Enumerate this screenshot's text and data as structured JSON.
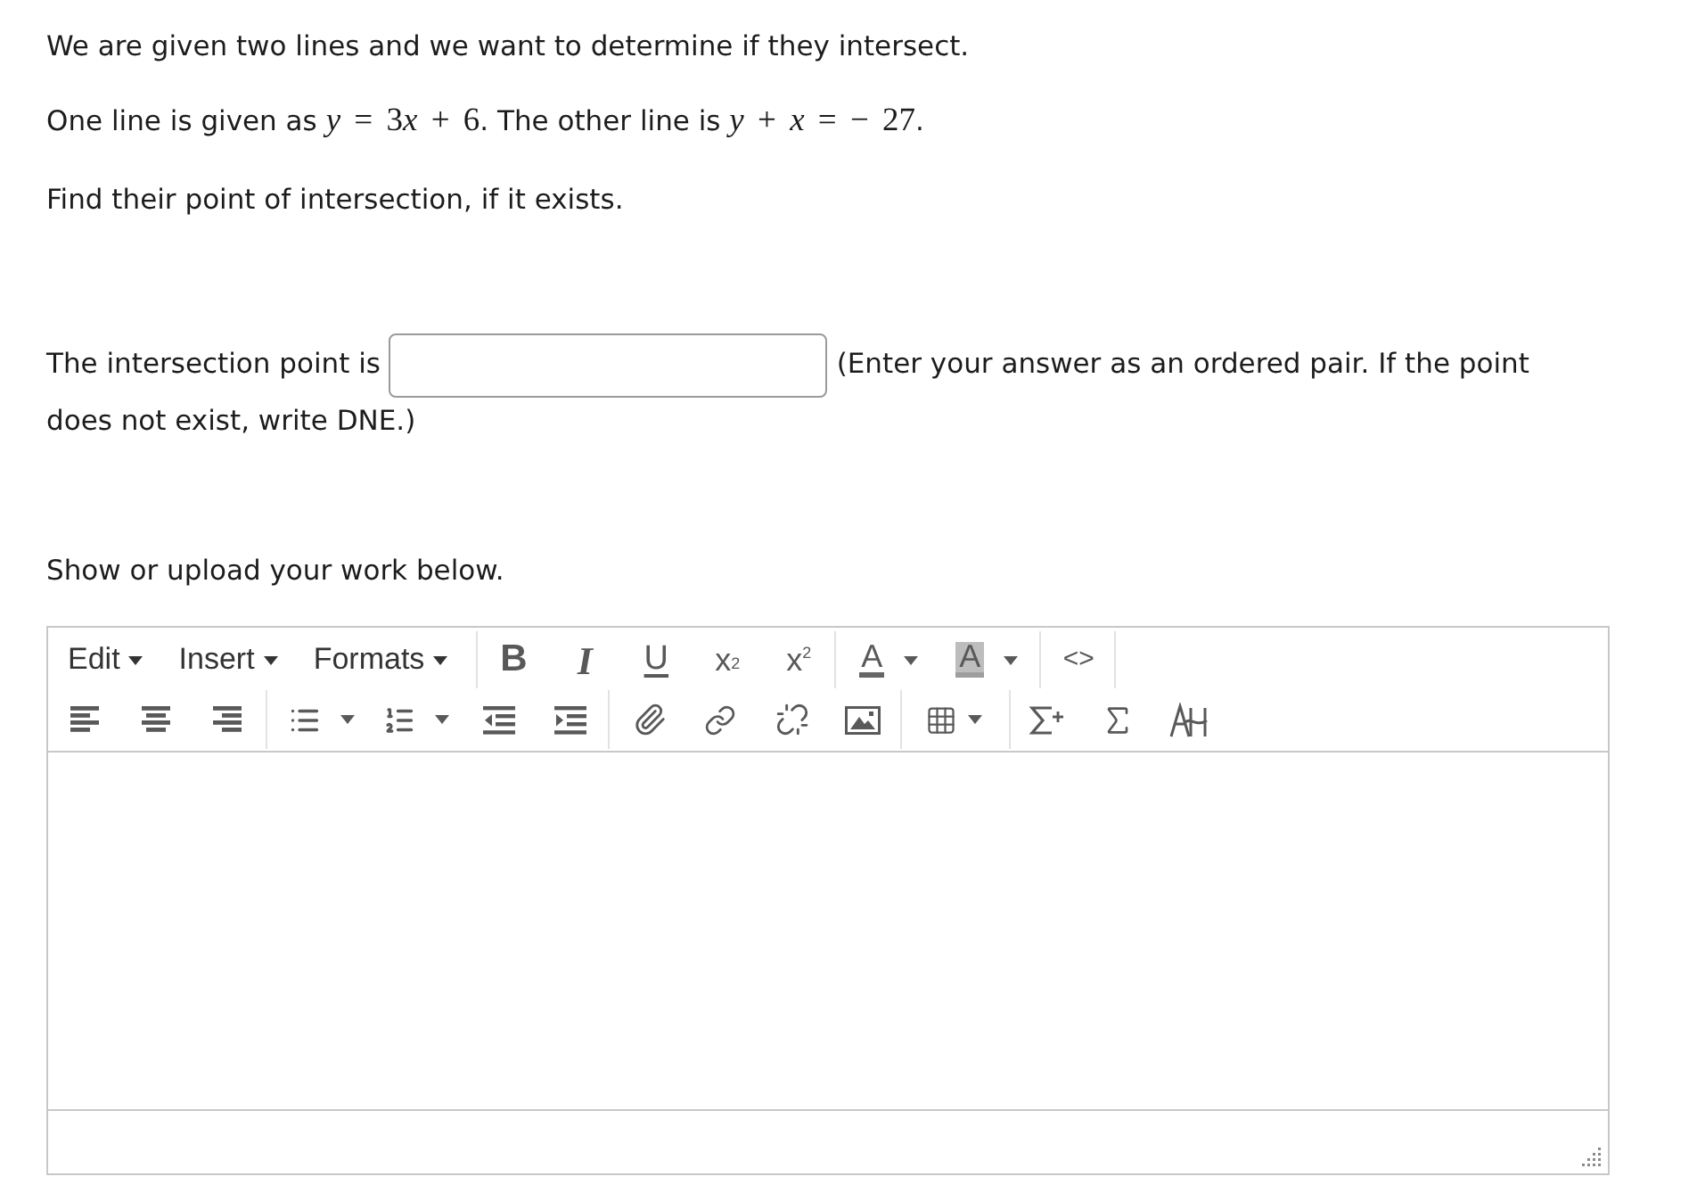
{
  "question": {
    "paragraphs": [
      {
        "segments": [
          {
            "kind": "text",
            "text": "We are given two lines and we want to determine if they intersect."
          }
        ]
      },
      {
        "segments": [
          {
            "kind": "text",
            "text": "One line is given as "
          },
          {
            "kind": "math_var",
            "text": "y"
          },
          {
            "kind": "math",
            "text": " = 3"
          },
          {
            "kind": "math_var",
            "text": "x"
          },
          {
            "kind": "math",
            "text": " + 6"
          },
          {
            "kind": "text",
            "text": ". The other line is "
          },
          {
            "kind": "math_var",
            "text": "y"
          },
          {
            "kind": "math",
            "text": " + "
          },
          {
            "kind": "math_var",
            "text": "x"
          },
          {
            "kind": "math",
            "text": " = − 27"
          },
          {
            "kind": "text",
            "text": "."
          }
        ]
      },
      {
        "segments": [
          {
            "kind": "text",
            "text": "Find their point of intersection, if it exists."
          }
        ]
      }
    ]
  },
  "answer": {
    "label": "The intersection point is",
    "hint": "(Enter your answer as an ordered pair. If the point does not exist, write DNE.)"
  },
  "work": {
    "prompt": "Show or upload your work below."
  },
  "editor": {
    "menus": [
      {
        "label": "Edit"
      },
      {
        "label": "Insert"
      },
      {
        "label": "Formats"
      }
    ],
    "format_buttons": [
      {
        "kind": "bold",
        "label": "B"
      },
      {
        "kind": "italic",
        "label": "I"
      },
      {
        "kind": "underline",
        "label": "U"
      },
      {
        "kind": "subscript",
        "label": "x$_{2}$"
      },
      {
        "kind": "superscript",
        "label": "x$^{2}$"
      }
    ],
    "color_buttons": [
      {
        "kind": "forecolor",
        "label": "A"
      },
      {
        "kind": "backcolor",
        "label": "A"
      }
    ],
    "code_button": {
      "label": "<>"
    }
  }
}
